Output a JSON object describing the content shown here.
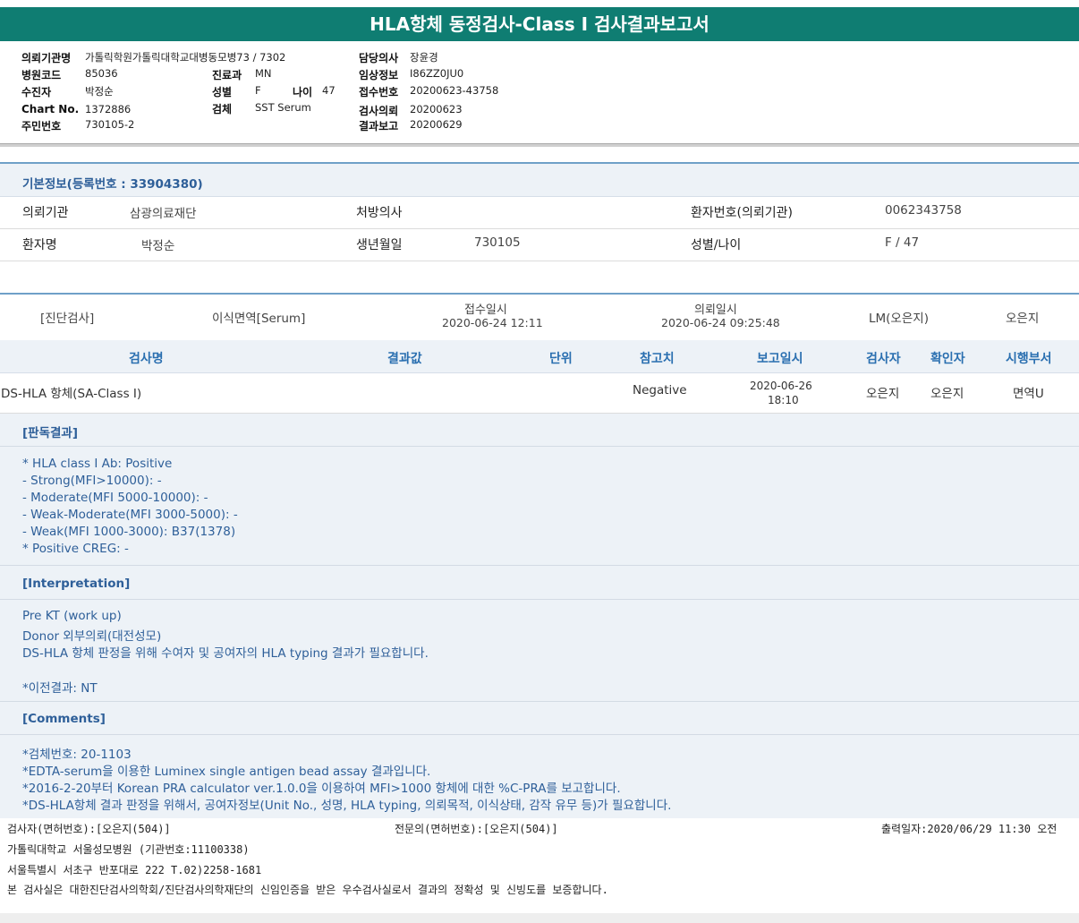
{
  "report": {
    "title": "HLA항체 동정검사-Class I 검사결과보고서"
  },
  "header": {
    "left": [
      {
        "label": "의뢰기관명",
        "value": "가톨릭학원가톨릭대학교대병동모병73 / 7302"
      },
      {
        "label": "병원코드",
        "value": "85036"
      },
      {
        "label": "수진자",
        "value": "박정순"
      },
      {
        "label": "Chart No.",
        "value": "1372886"
      },
      {
        "label": "주민번호",
        "value": "730105-2"
      }
    ],
    "middle": [
      {
        "label": "진료과",
        "value": "MN"
      },
      {
        "label": "성별",
        "value": "F"
      },
      {
        "label": "검체",
        "value": "SST Serum"
      }
    ],
    "age": {
      "label": "나이",
      "value": "47"
    },
    "right": [
      {
        "label": "담당의사",
        "value": "장윤경"
      },
      {
        "label": "임상정보",
        "value": "I86ZZ0JU0"
      },
      {
        "label": "접수번호",
        "value": "20200623-43758"
      },
      {
        "label": "검사의뢰",
        "value": "20200623"
      },
      {
        "label": "결과보고",
        "value": "20200629"
      }
    ]
  },
  "basic_info": {
    "title": "기본정보(등록번호 : 33904380)",
    "institution_label": "의뢰기관",
    "institution": "삼광의료재단",
    "doctor_label": "처방의사",
    "doctor": "",
    "patient_no_label": "환자번호(의뢰기관)",
    "patient_no": "0062343758",
    "name_label": "환자명",
    "name": "박정순",
    "birth_label": "생년월일",
    "birth": "730105",
    "sex_age_label": "성별/나이",
    "sex_age": "F / 47"
  },
  "order": {
    "category": "[진단검사]",
    "specimen": "이식면역[Serum]",
    "received_label": "접수일시",
    "received": "2020-06-24 12:11",
    "requested_label": "의뢰일시",
    "requested": "2020-06-24 09:25:48",
    "lm": "LM(오은지)",
    "staff": "오은지"
  },
  "table": {
    "headers": [
      "검사명",
      "결과값",
      "단위",
      "참고치",
      "보고일시",
      "검사자",
      "확인자",
      "시행부서"
    ],
    "rows": [
      {
        "name": "DS-HLA 항체(SA-Class I)",
        "result": "",
        "unit": "",
        "reference": "Negative",
        "report_date": "2020-06-26",
        "report_time": "18:10",
        "tester": "오은지",
        "confirmer": "오은지",
        "dept": "면역U"
      }
    ]
  },
  "interpretation": {
    "result_title": "[판독결과]",
    "result_lines": [
      "* HLA class I Ab: Positive",
      "- Strong(MFI>10000): -",
      "- Moderate(MFI 5000-10000): -",
      "- Weak-Moderate(MFI 3000-5000): -",
      "- Weak(MFI 1000-3000): B37(1378)",
      "* Positive CREG: -"
    ],
    "interp_title": "[Interpretation]",
    "interp_lines": [
      "Pre KT (work up)",
      "Donor 외부의뢰(대전성모)",
      "DS-HLA 항체 판정을 위해 수여자 및 공여자의 HLA typing 결과가 필요합니다."
    ],
    "prev_result": "*이전결과: NT",
    "comments_title": "[Comments]",
    "comment_lines": [
      "*검체번호: 20-1103",
      "*EDTA-serum을 이용한 Luminex single antigen bead assay 결과입니다.",
      "*2016-2-20부터 Korean PRA calculator ver.1.0.0을 이용하여 MFI>1000 항체에 대한 %C-PRA를 보고합니다.",
      "*DS-HLA항체 결과 판정을 위해서, 공여자정보(Unit No., 성명, HLA typing, 의뢰목적, 이식상태, 감작 유무 등)가 필요합니다."
    ]
  },
  "footer": {
    "tester": "검사자(면허번호):[오은지(504)]",
    "specialist": "전문의(면허번호):[오은지(504)]",
    "printed": "출력일자:2020/06/29 11:30 오전",
    "hospital": "가톨릭대학교 서울성모병원 (기관번호:11100338)",
    "address": "서울특별시 서초구 반포대로 222 T.02)2258-1681",
    "certification": "본 검사실은 대한진단검사의학회/진단검사의학재단의 신임인증을 받은 우수검사실로서 결과의 정확성 및 신빙도를 보증합니다."
  }
}
